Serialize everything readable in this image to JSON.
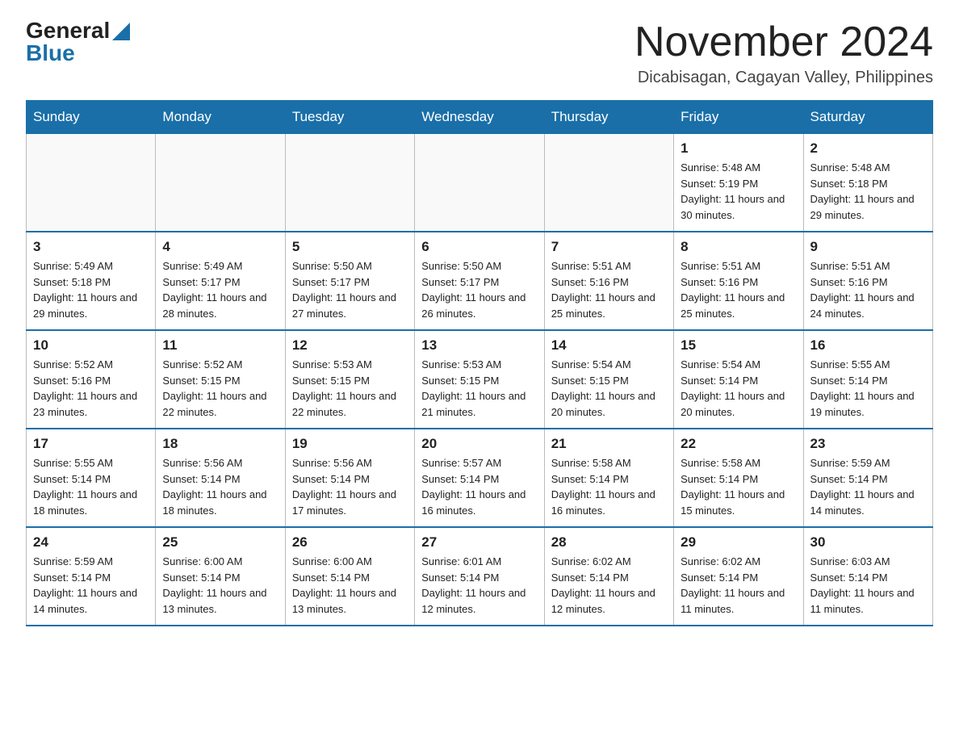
{
  "header": {
    "logo_general": "General",
    "logo_blue": "Blue",
    "month_year": "November 2024",
    "location": "Dicabisagan, Cagayan Valley, Philippines"
  },
  "weekdays": [
    "Sunday",
    "Monday",
    "Tuesday",
    "Wednesday",
    "Thursday",
    "Friday",
    "Saturday"
  ],
  "weeks": [
    [
      {
        "day": "",
        "sunrise": "",
        "sunset": "",
        "daylight": ""
      },
      {
        "day": "",
        "sunrise": "",
        "sunset": "",
        "daylight": ""
      },
      {
        "day": "",
        "sunrise": "",
        "sunset": "",
        "daylight": ""
      },
      {
        "day": "",
        "sunrise": "",
        "sunset": "",
        "daylight": ""
      },
      {
        "day": "",
        "sunrise": "",
        "sunset": "",
        "daylight": ""
      },
      {
        "day": "1",
        "sunrise": "Sunrise: 5:48 AM",
        "sunset": "Sunset: 5:19 PM",
        "daylight": "Daylight: 11 hours and 30 minutes."
      },
      {
        "day": "2",
        "sunrise": "Sunrise: 5:48 AM",
        "sunset": "Sunset: 5:18 PM",
        "daylight": "Daylight: 11 hours and 29 minutes."
      }
    ],
    [
      {
        "day": "3",
        "sunrise": "Sunrise: 5:49 AM",
        "sunset": "Sunset: 5:18 PM",
        "daylight": "Daylight: 11 hours and 29 minutes."
      },
      {
        "day": "4",
        "sunrise": "Sunrise: 5:49 AM",
        "sunset": "Sunset: 5:17 PM",
        "daylight": "Daylight: 11 hours and 28 minutes."
      },
      {
        "day": "5",
        "sunrise": "Sunrise: 5:50 AM",
        "sunset": "Sunset: 5:17 PM",
        "daylight": "Daylight: 11 hours and 27 minutes."
      },
      {
        "day": "6",
        "sunrise": "Sunrise: 5:50 AM",
        "sunset": "Sunset: 5:17 PM",
        "daylight": "Daylight: 11 hours and 26 minutes."
      },
      {
        "day": "7",
        "sunrise": "Sunrise: 5:51 AM",
        "sunset": "Sunset: 5:16 PM",
        "daylight": "Daylight: 11 hours and 25 minutes."
      },
      {
        "day": "8",
        "sunrise": "Sunrise: 5:51 AM",
        "sunset": "Sunset: 5:16 PM",
        "daylight": "Daylight: 11 hours and 25 minutes."
      },
      {
        "day": "9",
        "sunrise": "Sunrise: 5:51 AM",
        "sunset": "Sunset: 5:16 PM",
        "daylight": "Daylight: 11 hours and 24 minutes."
      }
    ],
    [
      {
        "day": "10",
        "sunrise": "Sunrise: 5:52 AM",
        "sunset": "Sunset: 5:16 PM",
        "daylight": "Daylight: 11 hours and 23 minutes."
      },
      {
        "day": "11",
        "sunrise": "Sunrise: 5:52 AM",
        "sunset": "Sunset: 5:15 PM",
        "daylight": "Daylight: 11 hours and 22 minutes."
      },
      {
        "day": "12",
        "sunrise": "Sunrise: 5:53 AM",
        "sunset": "Sunset: 5:15 PM",
        "daylight": "Daylight: 11 hours and 22 minutes."
      },
      {
        "day": "13",
        "sunrise": "Sunrise: 5:53 AM",
        "sunset": "Sunset: 5:15 PM",
        "daylight": "Daylight: 11 hours and 21 minutes."
      },
      {
        "day": "14",
        "sunrise": "Sunrise: 5:54 AM",
        "sunset": "Sunset: 5:15 PM",
        "daylight": "Daylight: 11 hours and 20 minutes."
      },
      {
        "day": "15",
        "sunrise": "Sunrise: 5:54 AM",
        "sunset": "Sunset: 5:14 PM",
        "daylight": "Daylight: 11 hours and 20 minutes."
      },
      {
        "day": "16",
        "sunrise": "Sunrise: 5:55 AM",
        "sunset": "Sunset: 5:14 PM",
        "daylight": "Daylight: 11 hours and 19 minutes."
      }
    ],
    [
      {
        "day": "17",
        "sunrise": "Sunrise: 5:55 AM",
        "sunset": "Sunset: 5:14 PM",
        "daylight": "Daylight: 11 hours and 18 minutes."
      },
      {
        "day": "18",
        "sunrise": "Sunrise: 5:56 AM",
        "sunset": "Sunset: 5:14 PM",
        "daylight": "Daylight: 11 hours and 18 minutes."
      },
      {
        "day": "19",
        "sunrise": "Sunrise: 5:56 AM",
        "sunset": "Sunset: 5:14 PM",
        "daylight": "Daylight: 11 hours and 17 minutes."
      },
      {
        "day": "20",
        "sunrise": "Sunrise: 5:57 AM",
        "sunset": "Sunset: 5:14 PM",
        "daylight": "Daylight: 11 hours and 16 minutes."
      },
      {
        "day": "21",
        "sunrise": "Sunrise: 5:58 AM",
        "sunset": "Sunset: 5:14 PM",
        "daylight": "Daylight: 11 hours and 16 minutes."
      },
      {
        "day": "22",
        "sunrise": "Sunrise: 5:58 AM",
        "sunset": "Sunset: 5:14 PM",
        "daylight": "Daylight: 11 hours and 15 minutes."
      },
      {
        "day": "23",
        "sunrise": "Sunrise: 5:59 AM",
        "sunset": "Sunset: 5:14 PM",
        "daylight": "Daylight: 11 hours and 14 minutes."
      }
    ],
    [
      {
        "day": "24",
        "sunrise": "Sunrise: 5:59 AM",
        "sunset": "Sunset: 5:14 PM",
        "daylight": "Daylight: 11 hours and 14 minutes."
      },
      {
        "day": "25",
        "sunrise": "Sunrise: 6:00 AM",
        "sunset": "Sunset: 5:14 PM",
        "daylight": "Daylight: 11 hours and 13 minutes."
      },
      {
        "day": "26",
        "sunrise": "Sunrise: 6:00 AM",
        "sunset": "Sunset: 5:14 PM",
        "daylight": "Daylight: 11 hours and 13 minutes."
      },
      {
        "day": "27",
        "sunrise": "Sunrise: 6:01 AM",
        "sunset": "Sunset: 5:14 PM",
        "daylight": "Daylight: 11 hours and 12 minutes."
      },
      {
        "day": "28",
        "sunrise": "Sunrise: 6:02 AM",
        "sunset": "Sunset: 5:14 PM",
        "daylight": "Daylight: 11 hours and 12 minutes."
      },
      {
        "day": "29",
        "sunrise": "Sunrise: 6:02 AM",
        "sunset": "Sunset: 5:14 PM",
        "daylight": "Daylight: 11 hours and 11 minutes."
      },
      {
        "day": "30",
        "sunrise": "Sunrise: 6:03 AM",
        "sunset": "Sunset: 5:14 PM",
        "daylight": "Daylight: 11 hours and 11 minutes."
      }
    ]
  ]
}
